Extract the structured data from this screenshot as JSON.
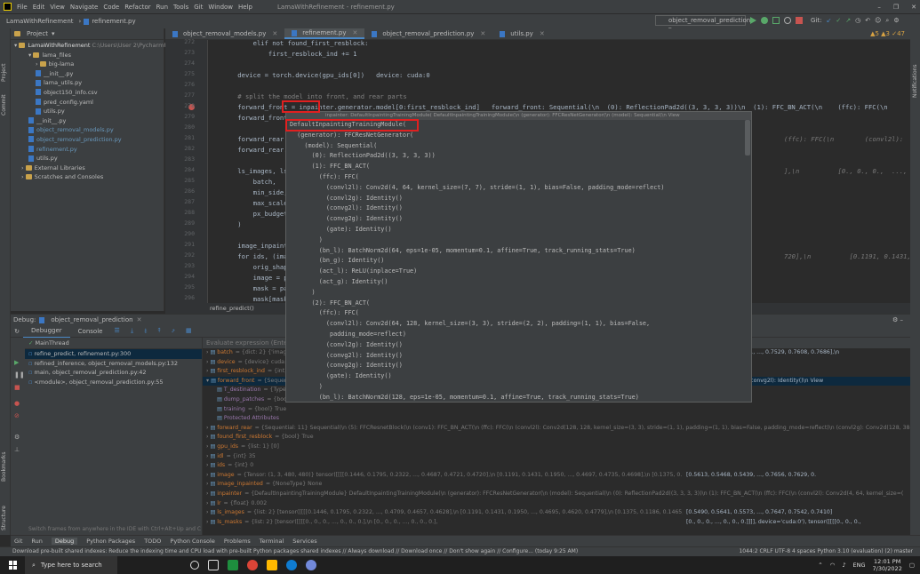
{
  "window": {
    "title": "LamaWithRefinement - refinement.py",
    "menu": [
      "File",
      "Edit",
      "View",
      "Navigate",
      "Code",
      "Refactor",
      "Run",
      "Tools",
      "Git",
      "Window",
      "Help"
    ],
    "controls": [
      "–",
      "❐",
      "✕"
    ]
  },
  "navbar": {
    "crumbs": [
      "LamaWithRefinement",
      "refinement.py"
    ],
    "run_config": "object_removal_prediction",
    "git_label": "Git:"
  },
  "project": {
    "header": "Project",
    "root": "LamaWithRefinement",
    "root_path": "C:\\Users\\User 2\\PycharmProj",
    "items": [
      {
        "label": "lama_files",
        "indent": 2,
        "kind": "folder"
      },
      {
        "label": "big-lama",
        "indent": 3,
        "kind": "folder"
      },
      {
        "label": "__init__.py",
        "indent": 3,
        "kind": "file"
      },
      {
        "label": "lama_utils.py",
        "indent": 3,
        "kind": "file"
      },
      {
        "label": "object150_info.csv",
        "indent": 3,
        "kind": "file"
      },
      {
        "label": "pred_config.yaml",
        "indent": 3,
        "kind": "file"
      },
      {
        "label": "utils.py",
        "indent": 3,
        "kind": "file"
      },
      {
        "label": "__init__.py",
        "indent": 2,
        "kind": "file"
      },
      {
        "label": "object_removal_models.py",
        "indent": 2,
        "kind": "file",
        "blue": true
      },
      {
        "label": "object_removal_prediction.py",
        "indent": 2,
        "kind": "file",
        "blue": true
      },
      {
        "label": "refinement.py",
        "indent": 2,
        "kind": "file",
        "blue": true
      },
      {
        "label": "utils.py",
        "indent": 2,
        "kind": "file"
      },
      {
        "label": "External Libraries",
        "indent": 1,
        "kind": "folder"
      },
      {
        "label": "Scratches and Consoles",
        "indent": 1,
        "kind": "folder"
      }
    ]
  },
  "tabs": [
    {
      "label": "object_removal_models.py",
      "active": false
    },
    {
      "label": "refinement.py",
      "active": true
    },
    {
      "label": "object_removal_prediction.py",
      "active": false
    },
    {
      "label": "utils.py",
      "active": false
    }
  ],
  "editor": {
    "warnings": "▲5 ▲3 ✓47",
    "line_numbers": [
      "272",
      "273",
      "274",
      "275",
      "276",
      "277",
      "278",
      "279",
      "280",
      "281",
      "282",
      "283",
      "284",
      "285",
      "286",
      "287",
      "288",
      "289",
      "290",
      "291",
      "292",
      "293",
      "294",
      "295",
      "296"
    ],
    "lines": [
      "        elif not found_first_resblock:",
      "            first_resblock_ind += 1",
      "",
      "    device = torch.device(gpu_ids[0])   device: cuda:0",
      "",
      "    # split the model into front, and rear parts",
      "    forward_front = inpainter.generator.model[0:first_resblock_ind]   forward_front: Sequential(\\n  (0): ReflectionPad2d((3, 3, 3, 3))\\n  (1): FFC_BN_ACT(\\n    (ffc): FFC(\\n",
      "    forward_front.to(device = inpainter",
      "",
      "    forward_rear = in",
      "    forward_rear.to(d",
      "",
      "    ls_images, ls_mas",
      "        batch,",
      "        min_side,",
      "        max_scales,",
      "        px_budget",
      "    )",
      "",
      "    image_inpainted =",
      "    for ids, (image,",
      "        orig_shape =",
      "        image = pad_t",
      "        mask = pad_te",
      "        mask[mask >="
    ],
    "right_fragments": [
      {
        "row": 9,
        "text": "(ffc): FFC(\\n        (convl2l):"
      },
      {
        "row": 12,
        "text": "],\\n          [0., 0., 0.,  ..., 0., 0"
      },
      {
        "row": 20,
        "text": "720],\\n          [0.1191, 0.1431, 0.19"
      }
    ],
    "breadcrumb": "refine_predict()"
  },
  "popup": {
    "header": "inpainter: DefaultInpaintingTrainingModule( DefaultInpaintingTrainingModule(\\n  (generator): FFCResNetGenerator(\\n    (model): Sequential(\\n  View",
    "lines": [
      "DefaultInpaintingTrainingModule(",
      "  (generator): FFCResNetGenerator(",
      "    (model): Sequential(",
      "      (0): ReflectionPad2d((3, 3, 3, 3))",
      "      (1): FFC_BN_ACT(",
      "        (ffc): FFC(",
      "          (convl2l): Conv2d(4, 64, kernel_size=(7, 7), stride=(1, 1), bias=False, padding_mode=reflect)",
      "          (convl2g): Identity()",
      "          (convg2l): Identity()",
      "          (convg2g): Identity()",
      "          (gate): Identity()",
      "        )",
      "        (bn_l): BatchNorm2d(64, eps=1e-05, momentum=0.1, affine=True, track_running_stats=True)",
      "        (bn_g): Identity()",
      "        (act_l): ReLU(inplace=True)",
      "        (act_g): Identity()",
      "      )",
      "      (2): FFC_BN_ACT(",
      "        (ffc): FFC(",
      "          (convl2l): Conv2d(64, 128, kernel_size=(3, 3), stride=(2, 2), padding=(1, 1), bias=False,",
      "           padding_mode=reflect)",
      "          (convl2g): Identity()",
      "          (convg2l): Identity()",
      "          (convg2g): Identity()",
      "          (gate): Identity()",
      "        )",
      "        (bn_l): BatchNorm2d(128, eps=1e-05, momentum=0.1, affine=True, track_running_stats=True)"
    ]
  },
  "debug": {
    "label": "Debug:",
    "config": "object_removal_prediction",
    "tabs": [
      "Debugger",
      "Console"
    ],
    "thread": "MainThread",
    "frames": [
      {
        "label": "refine_predict, refinement.py:300",
        "selected": true
      },
      {
        "label": "refined_inference, object_removal_models.py:132",
        "selected": false
      },
      {
        "label": "main, object_removal_prediction.py:42",
        "selected": false
      },
      {
        "label": "<module>, object_removal_prediction.py:55",
        "selected": false
      }
    ],
    "frames_hint": "Switch frames from anywhere in the IDE with Ctrl+Alt+Up and C",
    "eval_placeholder": "Evaluate expression (Enter) or add a watch (Ctrl+Shift+Enter)",
    "vars": [
      {
        "name": "batch",
        "type": "= {dict: 2} {'image':",
        "value": "[0.5490, 0.5333, 0.5451, ..., 0.7529, 0.7608, 0.7686],\\n",
        "indent": 0
      },
      {
        "name": "device",
        "type": "= {device} cuda:0",
        "value": "",
        "indent": 0
      },
      {
        "name": "first_resblock_ind",
        "type": "= {int} 5",
        "value": "",
        "indent": 0
      },
      {
        "name": "forward_front",
        "type": "= {Sequential}",
        "value": "(convl2g): Identity()\\n    (convg2l): Identity()\\n  View",
        "indent": 0,
        "selected": true
      },
      {
        "name": "T_destination",
        "type": "= {TypeV",
        "value": "",
        "indent": 1
      },
      {
        "name": "dump_patches",
        "type": "= {bool} False",
        "value": "",
        "indent": 1
      },
      {
        "name": "training",
        "type": "= {bool} True",
        "value": "",
        "indent": 1
      },
      {
        "name": "Protected Attributes",
        "type": "",
        "value": "",
        "indent": 1
      },
      {
        "name": "forward_rear",
        "type": "= {Sequential: 11} Sequential(\\n  (5): FFCResnetBlock(\\n    (conv1): FFC_BN_ACT(\\n      (ffc): FFC(\\n        (convl2l): Conv2d(128, 128, kernel_size=(3, 3), stride=(1, 1), padding=(1, 1), bias=False, padding_mode=reflect)\\n        (convl2g): Conv2d(128, 384, kern",
        "value": "",
        "indent": 0
      },
      {
        "name": "found_first_resblock",
        "type": "= {bool} True",
        "value": "",
        "indent": 0
      },
      {
        "name": "gpu_ids",
        "type": "= {list: 1} [0]",
        "value": "",
        "indent": 0
      },
      {
        "name": "idl",
        "type": "= {int} 35",
        "value": "",
        "indent": 0
      },
      {
        "name": "ids",
        "type": "= {int} 0",
        "value": "",
        "indent": 0
      },
      {
        "name": "image",
        "type": "= {Tensor: (1, 3, 480, 480)} tensor([[[[0.1446, 0.1795, 0.2322, ..., 0.4687, 0.4721, 0.4720],\\n          [0.1191, 0.1431, 0.1950, ..., 0.4697, 0.4735, 0.4698],\\n          [0.1375, 0.1186, 0.1465, ..., 0.4584, 0.4688, 0.4712],\\n  ...",
        "value": "[0.5613, 0.5468, 0.5439, ..., 0.7656, 0.7629, 0.",
        "indent": 0
      },
      {
        "name": "image_inpainted",
        "type": "= {NoneType} None",
        "value": "",
        "indent": 0
      },
      {
        "name": "inpainter",
        "type": "= {DefaultInpaintingTrainingModule} DefaultInpaintingTrainingModule(\\n  (generator): FFCResNetGenerator(\\n    (model): Sequential(\\n      (0): ReflectionPad2d((3, 3, 3, 3))\\n      (1): FFC_BN_ACT(\\n        (ffc): FFC(\\n          (convl2l): Conv2d(4, 64, kernel_size=(",
        "value": "",
        "indent": 0
      },
      {
        "name": "lr",
        "type": "= {float} 0.002",
        "value": "",
        "indent": 0
      },
      {
        "name": "ls_images",
        "type": "= {list: 2} [tensor([[[[0.1446, 0.1795, 0.2322, ..., 0.4709, 0.4657, 0.4628],\\n          [0.1191, 0.1431, 0.1950, ..., 0.4695, 0.4620, 0.4779],\\n          [0.1375, 0.1186, 0.1465, ..., 0.4359, 0.4561, 0.4566],\\n  ...",
        "value": "[0.5490, 0.5641, 0.5573, ..., 0.7647, 0.7542, 0.7410]",
        "indent": 0
      },
      {
        "name": "ls_masks",
        "type": "= {list: 2} [tensor([[[[0., 0., 0., ..., 0., 0., 0.],\\n          [0., 0., 0., ..., 0., 0., 0.],",
        "value": "[0., 0., 0., ..., 0., 0., 0.]]]], device='cuda:0'), tensor([[[[0., 0., 0.,",
        "indent": 0
      }
    ]
  },
  "toolwindows": [
    "Git",
    "Run",
    "Debug",
    "Python Packages",
    "TODO",
    "Python Console",
    "Problems",
    "Terminal",
    "Services"
  ],
  "statusbar": {
    "message": "Download pre-built shared indexes: Reduce the indexing time and CPU load with pre-built Python packages shared indexes // Always download // Download once // Don't show again // Configure... (today 9:25 AM)",
    "right": "1044:2  CRLF  UTF-8  4 spaces  Python 3.10 (evaluation) (2)  master"
  },
  "taskbar": {
    "search_placeholder": "Type here to search",
    "time": "12:01 PM",
    "date": "7/30/2022",
    "lang": "ENG"
  },
  "sidebar_labels": [
    "Project",
    "Commit",
    "Bookmarks",
    "Structure"
  ],
  "right_label": "Notifications",
  "colors": {
    "accent": "#4a88c7",
    "highlight_box": "#e02020",
    "breakpoint_line": "#52242e"
  }
}
